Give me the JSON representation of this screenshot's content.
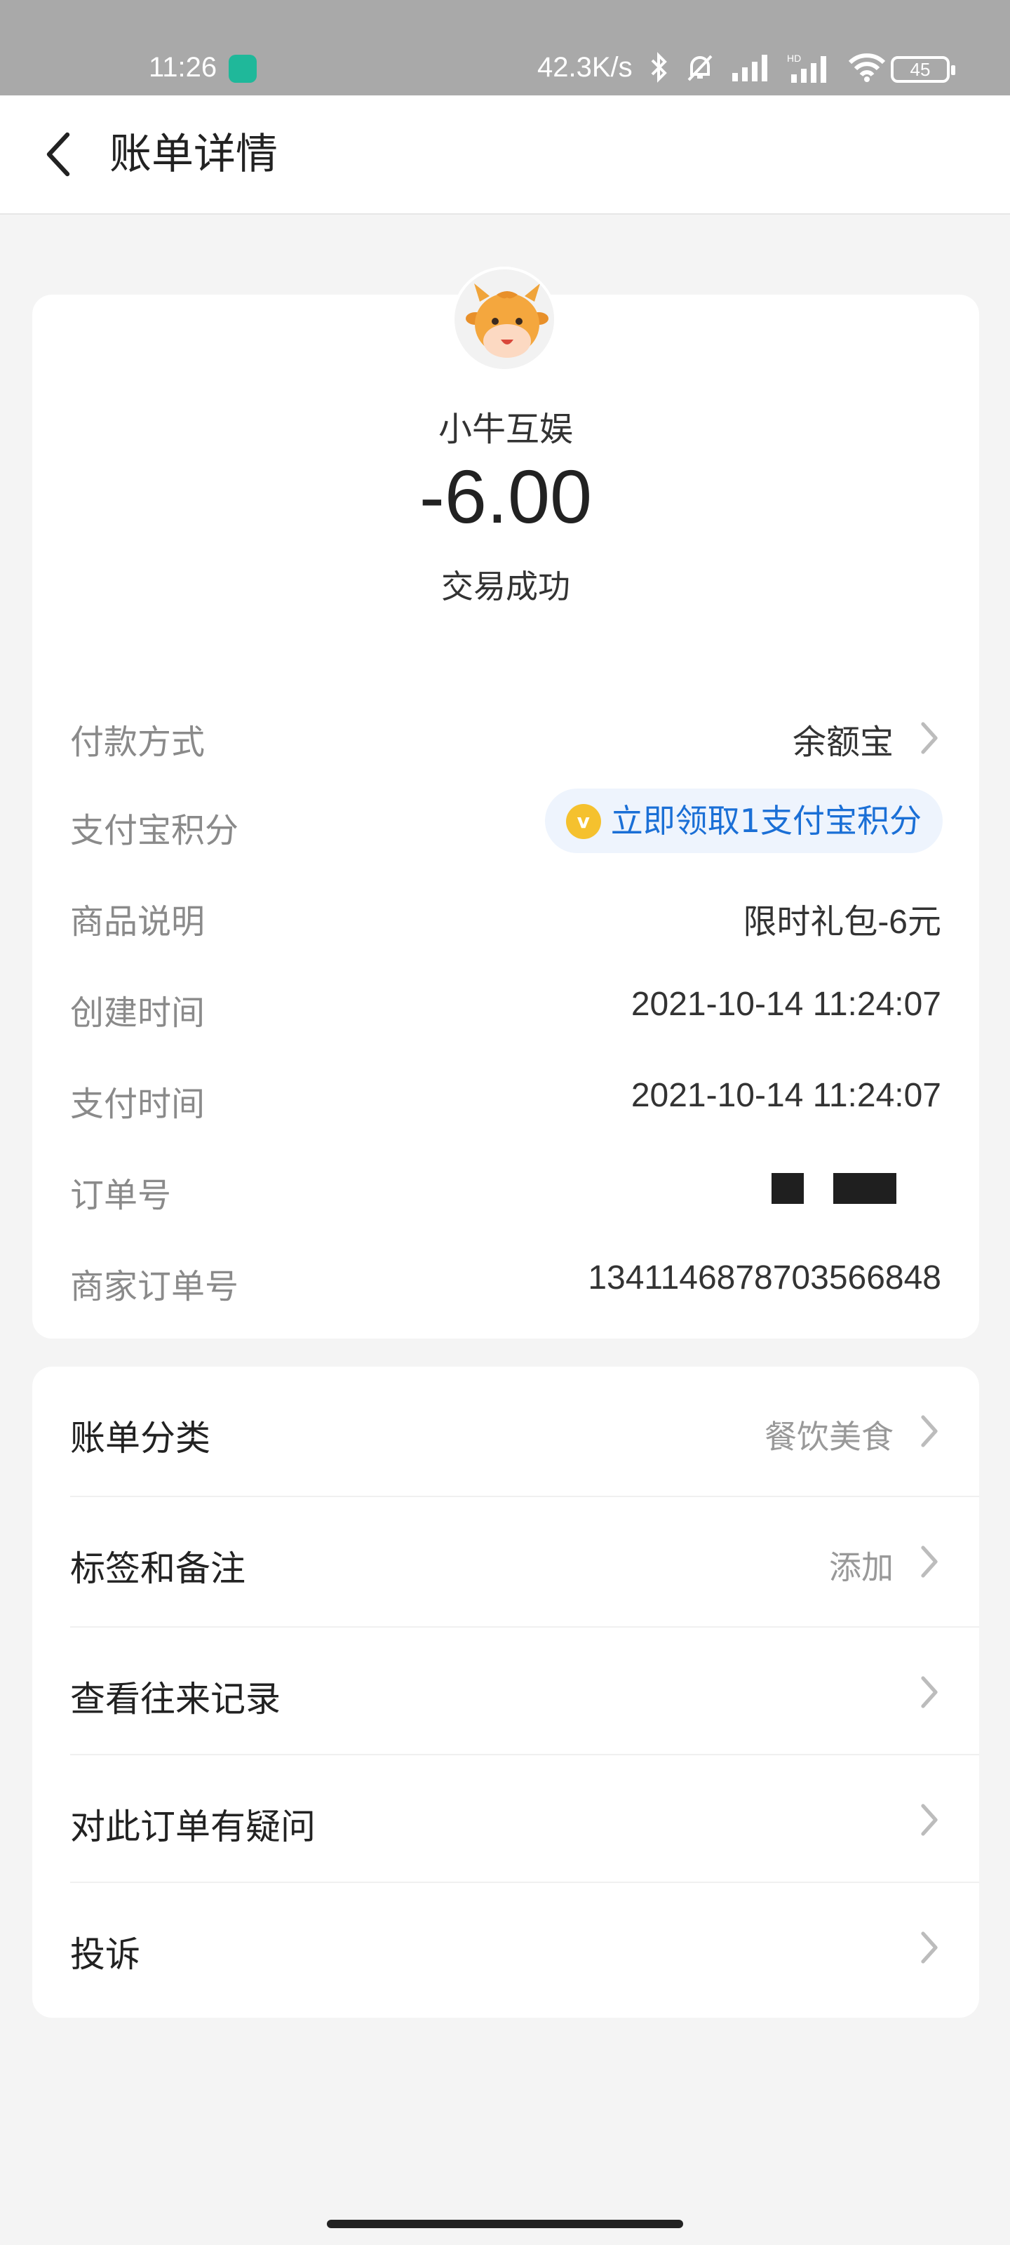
{
  "status_bar": {
    "time": "11:26",
    "network_speed": "42.3K/s",
    "battery": "45",
    "icons": [
      "app-notification-icon",
      "bluetooth-icon",
      "mute-bell-icon",
      "signal-icon",
      "hd-signal-icon",
      "wifi-icon",
      "battery-icon"
    ]
  },
  "nav": {
    "title": "账单详情",
    "back_icon": "chevron-left-icon"
  },
  "summary": {
    "merchant": "小牛互娱",
    "amount": "-6.00",
    "status": "交易成功"
  },
  "details": [
    {
      "label": "付款方式",
      "value": "余额宝"
    },
    {
      "label": "支付宝积分",
      "value": "立即领取1支付宝积分"
    },
    {
      "label": "商品说明",
      "value": "限时礼包-6元"
    },
    {
      "label": "创建时间",
      "value": "2021-10-14 11:24:07"
    },
    {
      "label": "支付时间",
      "value": "2021-10-14 11:24:07"
    },
    {
      "label": "订单号",
      "value": ""
    },
    {
      "label": "商家订单号",
      "value": "1341146878703566848"
    }
  ],
  "menu": [
    {
      "label": "账单分类",
      "hint": "餐饮美食"
    },
    {
      "label": "标签和备注",
      "hint": "添加"
    },
    {
      "label": "查看往来记录",
      "hint": ""
    },
    {
      "label": "对此订单有疑问",
      "hint": ""
    },
    {
      "label": "投诉",
      "hint": ""
    }
  ],
  "colors": {
    "status_bar_bg": "#a9a9a9",
    "page_bg": "#f4f4f4",
    "link_blue": "#1a6fd6",
    "coin_gold": "#f5c12e"
  }
}
